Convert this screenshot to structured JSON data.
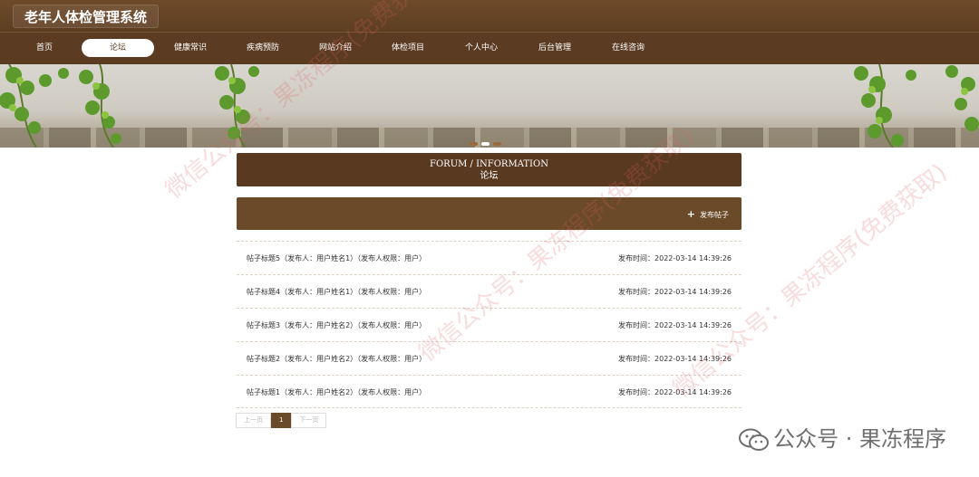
{
  "header": {
    "site_title": "老年人体检管理系统"
  },
  "nav": {
    "items": [
      {
        "label": "首页"
      },
      {
        "label": "论坛",
        "active": true
      },
      {
        "label": "健康常识"
      },
      {
        "label": "疾病预防"
      },
      {
        "label": "网站介绍"
      },
      {
        "label": "体检项目"
      },
      {
        "label": "个人中心"
      },
      {
        "label": "后台管理"
      },
      {
        "label": "在线咨询"
      }
    ]
  },
  "section": {
    "title_en": "FORUM / INFORMATION",
    "title_cn": "论坛"
  },
  "actions": {
    "post_label": "发布帖子"
  },
  "posts": [
    {
      "title": "帖子标题5（发布人：用户姓名1）（发布人权限：用户）",
      "time": "发布时间：2022-03-14 14:39:26"
    },
    {
      "title": "帖子标题4（发布人：用户姓名1）（发布人权限：用户）",
      "time": "发布时间：2022-03-14 14:39:26"
    },
    {
      "title": "帖子标题3（发布人：用户姓名2）（发布人权限：用户）",
      "time": "发布时间：2022-03-14 14:39:26"
    },
    {
      "title": "帖子标题2（发布人：用户姓名2）（发布人权限：用户）",
      "time": "发布时间：2022-03-14 14:39:26"
    },
    {
      "title": "帖子标题1（发布人：用户姓名2）（发布人权限：用户）",
      "time": "发布时间：2022-03-14 14:39:26"
    }
  ],
  "pagination": {
    "prev": "上一页",
    "current": "1",
    "next": "下一页"
  },
  "watermark": {
    "text": "公众号 · 果冻程序",
    "diagonal": "微信公众号：果冻程序(免费获取)"
  },
  "colors": {
    "primary": "#5b3c22",
    "bar": "#6b4a2a"
  }
}
